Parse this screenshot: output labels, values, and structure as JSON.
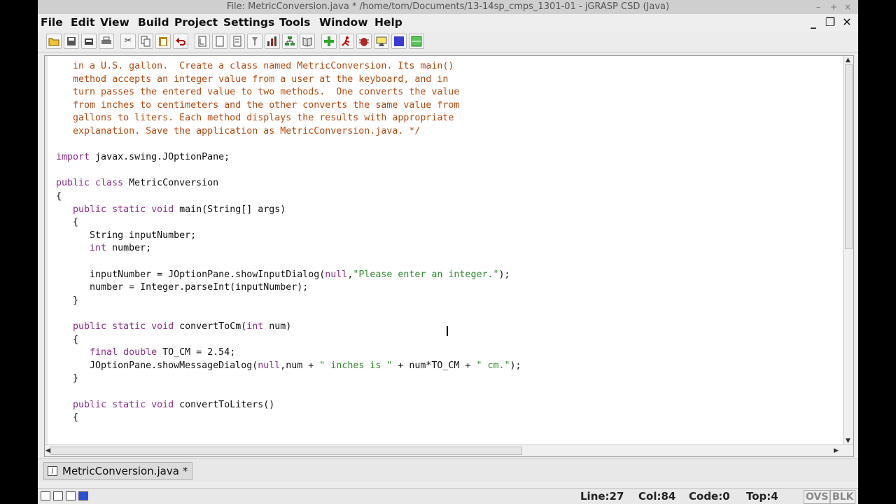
{
  "window": {
    "title": "File: MetricConversion.java *  /home/tom/Documents/13-14sp_cmps_1301-01 - jGRASP CSD (Java)",
    "controls": [
      "–",
      "+",
      "×"
    ]
  },
  "menubar": {
    "items": [
      "File",
      "Edit",
      "View",
      "Build",
      "Project",
      "Settings",
      "Tools",
      "Window",
      "Help"
    ],
    "mdi_controls": [
      "_",
      "❐",
      "✕"
    ]
  },
  "toolbar": {
    "icons": [
      "open-icon",
      "save-icon",
      "save-all-icon",
      "print-icon",
      "cut-icon",
      "copy-icon",
      "paste-icon",
      "undo-icon",
      "generate-csd-icon",
      "remove-csd-icon",
      "fold-icon",
      "unfold-icon",
      "uml-icon",
      "compile-icon",
      "browse-icon",
      "run-icon",
      "debug-icon",
      "bug-icon",
      "step-icon",
      "interactions-icon",
      "workbench-icon"
    ]
  },
  "editor": {
    "lines": [
      {
        "indent": "   ",
        "parts": [
          {
            "t": "in a U.S. gallon.  Create a class named MetricConversion. Its main()",
            "c": "cm"
          }
        ]
      },
      {
        "indent": "   ",
        "parts": [
          {
            "t": "method accepts an integer value from a user at the keyboard, and in",
            "c": "cm"
          }
        ]
      },
      {
        "indent": "   ",
        "parts": [
          {
            "t": "turn passes the entered value to two methods.  One converts the value",
            "c": "cm"
          }
        ]
      },
      {
        "indent": "   ",
        "parts": [
          {
            "t": "from inches to centimeters and the other converts the same value from",
            "c": "cm"
          }
        ]
      },
      {
        "indent": "   ",
        "parts": [
          {
            "t": "gallons to liters. Each method displays the results with appropriate",
            "c": "cm"
          }
        ]
      },
      {
        "indent": "   ",
        "parts": [
          {
            "t": "explanation. Save the application as MetricConversion.java. */",
            "c": "cm"
          }
        ]
      },
      {
        "indent": "",
        "parts": []
      },
      {
        "indent": "",
        "parts": [
          {
            "t": "import",
            "c": "kw"
          },
          {
            "t": " javax.swing.JOptionPane;",
            "c": ""
          }
        ]
      },
      {
        "indent": "",
        "parts": []
      },
      {
        "indent": "",
        "parts": [
          {
            "t": "public class",
            "c": "kw"
          },
          {
            "t": " MetricConversion",
            "c": ""
          }
        ]
      },
      {
        "indent": "",
        "parts": [
          {
            "t": "{",
            "c": ""
          }
        ]
      },
      {
        "indent": "   ",
        "parts": [
          {
            "t": "public static void",
            "c": "kw"
          },
          {
            "t": " main(String[] args)",
            "c": ""
          }
        ]
      },
      {
        "indent": "   ",
        "parts": [
          {
            "t": "{",
            "c": ""
          }
        ]
      },
      {
        "indent": "      ",
        "parts": [
          {
            "t": "String inputNumber;",
            "c": ""
          }
        ]
      },
      {
        "indent": "      ",
        "parts": [
          {
            "t": "int",
            "c": "kw"
          },
          {
            "t": " number;",
            "c": ""
          }
        ]
      },
      {
        "indent": "",
        "parts": []
      },
      {
        "indent": "      ",
        "parts": [
          {
            "t": "inputNumber = JOptionPane.showInputDialog(",
            "c": ""
          },
          {
            "t": "null",
            "c": "kw"
          },
          {
            "t": ",",
            "c": ""
          },
          {
            "t": "\"Please enter an integer.\"",
            "c": "st"
          },
          {
            "t": ");",
            "c": ""
          }
        ]
      },
      {
        "indent": "      ",
        "parts": [
          {
            "t": "number = Integer.parseInt(inputNumber);",
            "c": ""
          }
        ]
      },
      {
        "indent": "   ",
        "parts": [
          {
            "t": "}",
            "c": ""
          }
        ]
      },
      {
        "indent": "",
        "parts": []
      },
      {
        "indent": "   ",
        "parts": [
          {
            "t": "public static void",
            "c": "kw"
          },
          {
            "t": " convertToCm(",
            "c": ""
          },
          {
            "t": "int",
            "c": "kw"
          },
          {
            "t": " num)",
            "c": ""
          }
        ]
      },
      {
        "indent": "   ",
        "parts": [
          {
            "t": "{",
            "c": ""
          }
        ]
      },
      {
        "indent": "      ",
        "parts": [
          {
            "t": "final double",
            "c": "kw"
          },
          {
            "t": " TO_CM = 2.54;",
            "c": ""
          }
        ]
      },
      {
        "indent": "      ",
        "parts": [
          {
            "t": "JOptionPane.showMessageDialog(",
            "c": ""
          },
          {
            "t": "null",
            "c": "kw"
          },
          {
            "t": ",num + ",
            "c": ""
          },
          {
            "t": "\" inches is \"",
            "c": "st"
          },
          {
            "t": " + num*TO_CM + ",
            "c": ""
          },
          {
            "t": "\" cm.\"",
            "c": "st"
          },
          {
            "t": ");",
            "c": ""
          }
        ]
      },
      {
        "indent": "   ",
        "parts": [
          {
            "t": "}",
            "c": ""
          }
        ]
      },
      {
        "indent": "",
        "parts": []
      },
      {
        "indent": "   ",
        "parts": [
          {
            "t": "public static void",
            "c": "kw"
          },
          {
            "t": " convertToLiters()",
            "c": ""
          }
        ]
      },
      {
        "indent": "   ",
        "parts": [
          {
            "t": "{",
            "c": ""
          }
        ]
      }
    ]
  },
  "tabs": {
    "active_label": "MetricConversion.java *"
  },
  "statusbar": {
    "line": "Line:27",
    "col": "Col:84",
    "code": "Code:0",
    "top": "Top:4",
    "ovs": "OVS",
    "blk": "BLK"
  }
}
